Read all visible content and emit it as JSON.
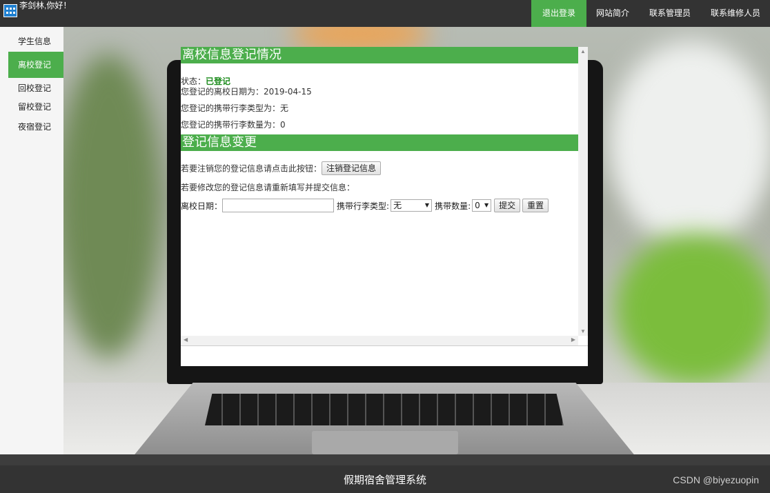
{
  "header": {
    "welcome": "李剑林,你好！",
    "nav": [
      "退出登录",
      "网站简介",
      "联系管理员",
      "联系维修人员"
    ]
  },
  "sidebar": {
    "items": [
      {
        "label": "学生信息",
        "active": false
      },
      {
        "label": "离校登记",
        "active": true
      },
      {
        "label": "回校登记",
        "active": false
      },
      {
        "label": "留校登记",
        "active": false
      },
      {
        "label": "夜宿登记",
        "active": false
      }
    ]
  },
  "main": {
    "section1_title": "离校信息登记情况",
    "status_label": "状态：",
    "status_value": "已登记",
    "leave_date_text": "您登记的离校日期为：2019-04-15",
    "luggage_type_text": "您登记的携带行李类型为：无",
    "luggage_count_text": "您登记的携带行李数量为：0",
    "section2_title": "登记信息变更",
    "cancel_prompt": "若要注销您的登记信息请点击此按钮：",
    "cancel_button": "注销登记信息",
    "modify_prompt": "若要修改您的登记信息请重新填写并提交信息：",
    "form": {
      "date_label": "离校日期：",
      "date_value": "",
      "type_label": "携带行李类型:",
      "type_selected": "无",
      "count_label": "携带数量:",
      "count_selected": "0",
      "submit_label": "提交",
      "reset_label": "重置"
    }
  },
  "footer": {
    "title": "假期宿舍管理系统",
    "watermark": "CSDN @biyezuopin"
  },
  "colors": {
    "accent": "#4cae4c",
    "topbar": "#333333",
    "status": "#1a8a1a"
  }
}
